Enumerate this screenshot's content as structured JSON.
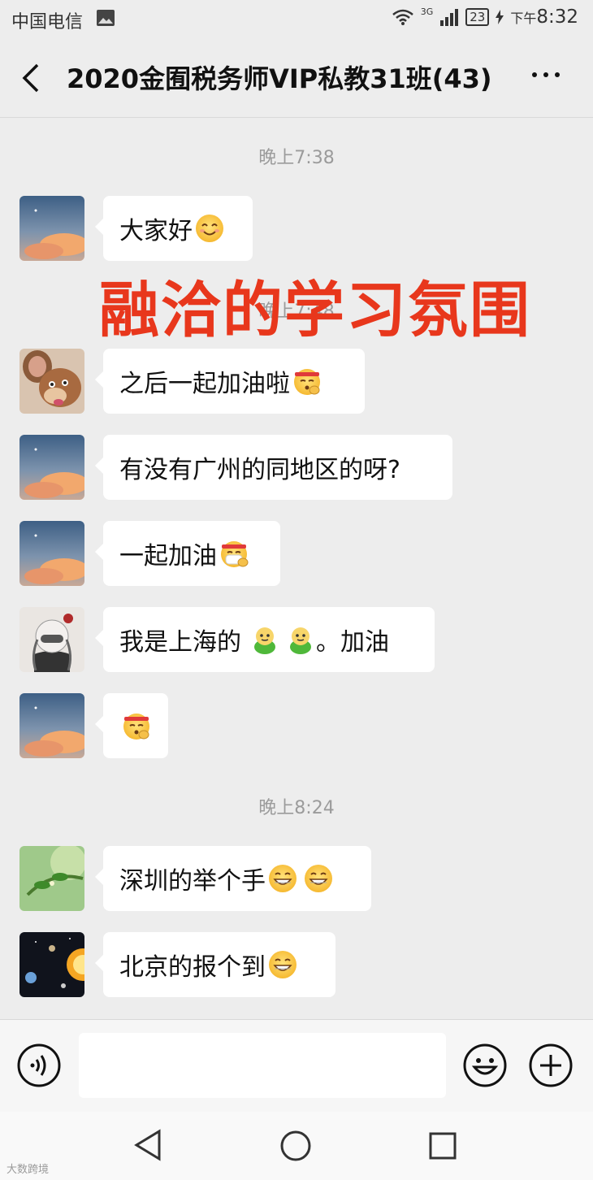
{
  "status": {
    "carrier": "中国电信",
    "network": "3G",
    "battery": "23",
    "time_prefix": "下午",
    "time": "8:32"
  },
  "header": {
    "title": "2020金囿税务师VIP私教31班(43)"
  },
  "overlay": {
    "caption": "融洽的学习氛围"
  },
  "timestamps": [
    "晚上7:38",
    "晚上7:48",
    "晚上8:24"
  ],
  "messages": [
    {
      "text": "大家好",
      "emojis": [
        "smile-emoji"
      ]
    },
    {
      "text": "之后一起加油啦",
      "emojis": [
        "headband-emoji"
      ]
    },
    {
      "text": "有没有广州的同地区的呀?",
      "emojis": []
    },
    {
      "text": "一起加油",
      "emojis": [
        "mask-emoji"
      ]
    },
    {
      "text": "我是上海的",
      "text_after": "。加油",
      "emojis": [
        "frog-emoji",
        "frog-emoji"
      ]
    },
    {
      "text": "",
      "emojis": [
        "headband-emoji"
      ]
    },
    {
      "text": "深圳的举个手",
      "emojis": [
        "grin-emoji",
        "grin-emoji"
      ]
    },
    {
      "text": "北京的报个到",
      "emojis": [
        "grin-emoji"
      ]
    }
  ],
  "input": {
    "value": "",
    "placeholder": ""
  },
  "colors": {
    "background": "#ededed",
    "bubble": "#ffffff",
    "caption": "#e8371c"
  },
  "watermark": "大数跨境"
}
